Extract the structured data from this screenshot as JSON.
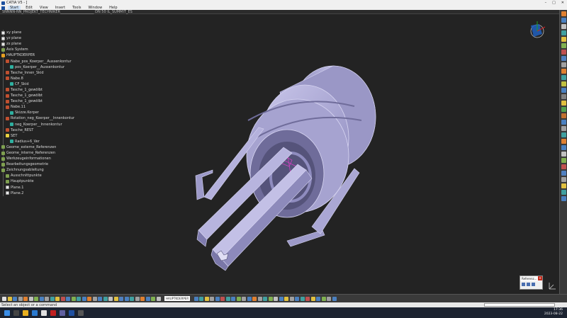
{
  "window": {
    "title": "CATIA V5 - [",
    "controls": [
      "–",
      "□",
      "✕"
    ]
  },
  "menu": {
    "items": [
      "Start",
      "Edit",
      "View",
      "Insert",
      "Tools",
      "Window",
      "Help"
    ]
  },
  "document": {
    "tab": "SNNNN-NN_PROJEKT_TECHNIKER___________________ DN 50 IL_SUMMIT_ES"
  },
  "tree": {
    "nodes": [
      {
        "label": "xy plane",
        "icon": "plane",
        "depth": 0
      },
      {
        "label": "yz plane",
        "icon": "plane",
        "depth": 0
      },
      {
        "label": "zx plane",
        "icon": "plane",
        "depth": 0
      },
      {
        "label": "Axis System",
        "icon": "gset",
        "depth": 0
      },
      {
        "label": "HAUPTKOERPER",
        "icon": "body",
        "depth": 0
      },
      {
        "label": "Nabe_pos_Koerper__Aussenkontur",
        "icon": "feat",
        "depth": 1
      },
      {
        "label": "pos_Koerper__Aussenkontur",
        "icon": "sketch",
        "depth": 2
      },
      {
        "label": "Tasche_Innen_Skid",
        "icon": "feat",
        "depth": 1
      },
      {
        "label": "Nabe.8",
        "icon": "feat",
        "depth": 1
      },
      {
        "label": "CF_Skid",
        "icon": "sketch",
        "depth": 2
      },
      {
        "label": "Tasche_1_gewölbt",
        "icon": "feat",
        "depth": 1
      },
      {
        "label": "Tasche_1_gewölbt",
        "icon": "feat",
        "depth": 1
      },
      {
        "label": "Tasche_1_gewölbt",
        "icon": "feat",
        "depth": 1
      },
      {
        "label": "Nabe.11",
        "icon": "feat",
        "depth": 1
      },
      {
        "label": "Skizze.Korper",
        "icon": "sketch",
        "depth": 2
      },
      {
        "label": "Rotation_neg_Koerper__Innenkontur",
        "icon": "feat",
        "depth": 1
      },
      {
        "label": "neg_Koerper__Innenkontur",
        "icon": "sketch",
        "depth": 2
      },
      {
        "label": "Tasche_REST",
        "icon": "feat",
        "depth": 1
      },
      {
        "label": "SET",
        "icon": "sel",
        "depth": 1
      },
      {
        "label": "Radius+6_Ver",
        "icon": "sketch",
        "depth": 2
      },
      {
        "label": "Geome_externe_Referenzen",
        "icon": "gset",
        "depth": 0
      },
      {
        "label": "Geome_interne_Referenzen",
        "icon": "gset",
        "depth": 0
      },
      {
        "label": "Werkzeugeinformationen",
        "icon": "gset",
        "depth": 0
      },
      {
        "label": "Bearbeitungsgeometrie",
        "icon": "gset",
        "depth": 0
      },
      {
        "label": "Zeichnungsableitung",
        "icon": "gset",
        "depth": 0
      },
      {
        "label": "Ausschnittpunkte",
        "icon": "gset",
        "depth": 1
      },
      {
        "label": "Hauptpunkte",
        "icon": "gset",
        "depth": 1
      },
      {
        "label": "Plane.1",
        "icon": "plane",
        "depth": 1
      },
      {
        "label": "Plane.2",
        "icon": "plane",
        "depth": 1
      }
    ]
  },
  "reference_window": {
    "title": "Referenz..."
  },
  "toolbar": {
    "current_body": "HAUPTKOERPER"
  },
  "status": {
    "message": "Select an object or a command"
  },
  "taskbar": {
    "time": "17:36",
    "date": "2023-08-22"
  },
  "colors": {
    "model_face": "#a9a6d2",
    "model_edge": "#d8d6f2",
    "model_shadow": "#6f6c9a",
    "background": "#232323"
  }
}
